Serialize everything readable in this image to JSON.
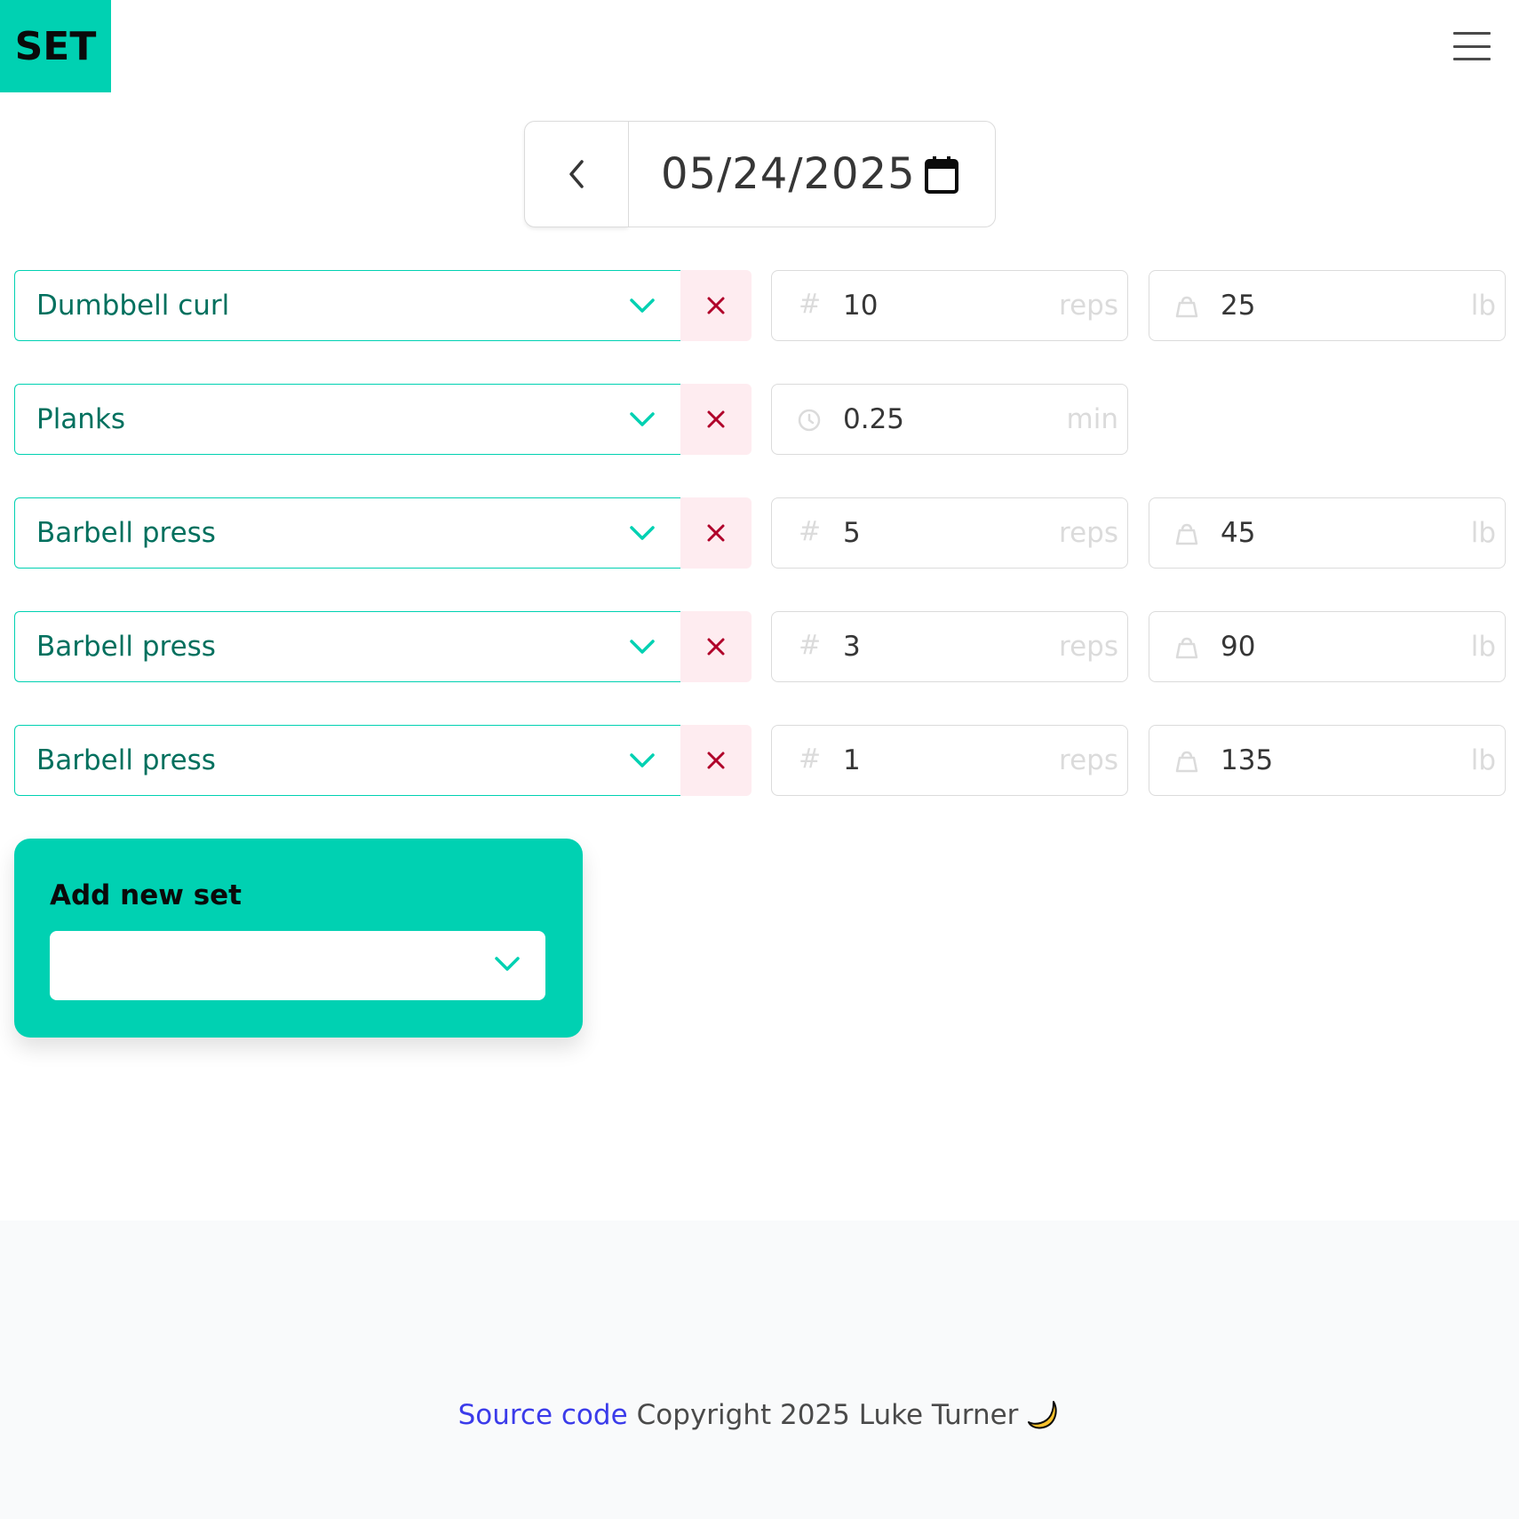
{
  "app": {
    "brand": "SET",
    "accent_color": "#00d1b2",
    "menu_icon": "hamburger-icon"
  },
  "date_nav": {
    "prev_icon": "chevron-left-icon",
    "date": "05/24/2025",
    "calendar_icon": "calendar-icon"
  },
  "sets": [
    {
      "exercise": "Dumbbell curl",
      "kind": "reps",
      "count": "10",
      "count_unit": "reps",
      "weight": "25",
      "weight_unit": "lb"
    },
    {
      "exercise": "Planks",
      "kind": "time",
      "count": "0.25",
      "count_unit": "min"
    },
    {
      "exercise": "Barbell press",
      "kind": "reps",
      "count": "5",
      "count_unit": "reps",
      "weight": "45",
      "weight_unit": "lb"
    },
    {
      "exercise": "Barbell press",
      "kind": "reps",
      "count": "3",
      "count_unit": "reps",
      "weight": "90",
      "weight_unit": "lb"
    },
    {
      "exercise": "Barbell press",
      "kind": "reps",
      "count": "1",
      "count_unit": "reps",
      "weight": "135",
      "weight_unit": "lb"
    }
  ],
  "add_set": {
    "title": "Add new set",
    "value": ""
  },
  "footer": {
    "link": "Source code",
    "text": "Copyright 2025 Luke Turner",
    "emoji": "moon-icon"
  }
}
